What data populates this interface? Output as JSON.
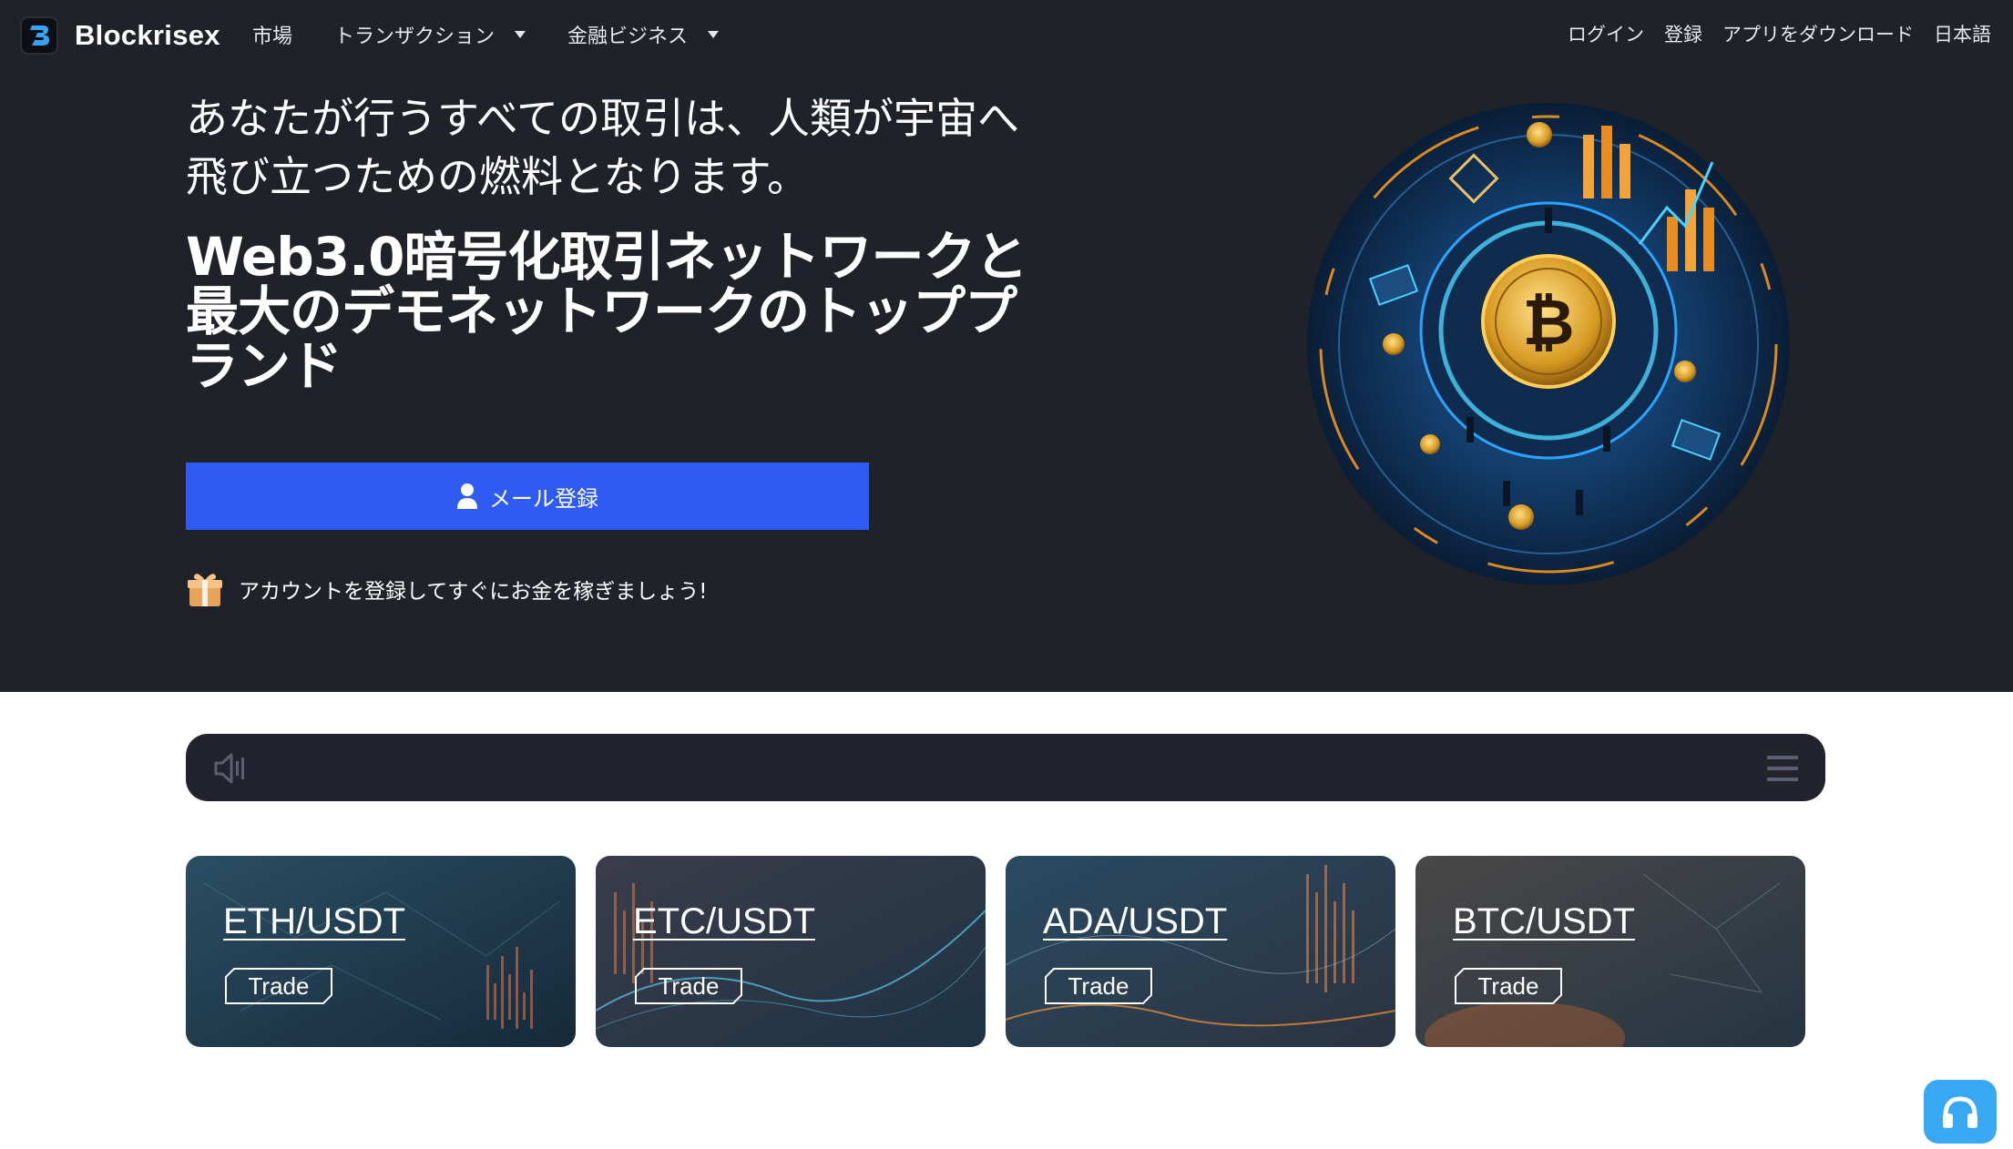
{
  "header": {
    "brand": "Blockrisex",
    "nav_left": [
      {
        "label": "市場"
      },
      {
        "label": "トランザクション"
      },
      {
        "label": "金融ビジネス"
      }
    ],
    "nav_right": [
      {
        "label": "ログイン"
      },
      {
        "label": "登録"
      },
      {
        "label": "アプリをダウンロード"
      },
      {
        "label": "日本語"
      }
    ]
  },
  "hero": {
    "headline_line1": "あなたが行うすべての取引は、人類が宇宙へ",
    "headline_line2": "飛び立つための燃料となります。",
    "subhead_line1": "Web3.0暗号化取引ネットワークと",
    "subhead_line2": "最大のデモネットワークのトッププ",
    "subhead_line3": "ランド",
    "cta_label": "メール登録",
    "promo_text": "アカウントを登録してすぐにお金を稼ぎましょう!"
  },
  "ticker": {
    "speaker_icon": "speaker-icon",
    "menu_icon": "menu-icon"
  },
  "pairs": [
    {
      "pair": "ETH/USDT",
      "action": "Trade"
    },
    {
      "pair": "ETC/USDT",
      "action": "Trade"
    },
    {
      "pair": "ADA/USDT",
      "action": "Trade"
    },
    {
      "pair": "BTC/USDT",
      "action": "Trade"
    }
  ],
  "support": {
    "icon": "headset-icon"
  },
  "colors": {
    "hero_bg": "#1f2229",
    "cta_blue": "#2f5bf3",
    "ticker_bg": "#22232c",
    "support_blue": "#38a8f5"
  }
}
